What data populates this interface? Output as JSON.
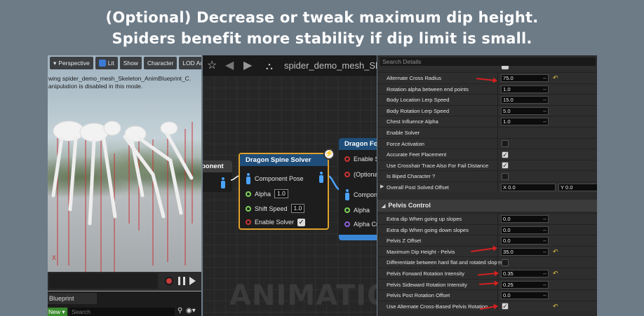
{
  "caption": {
    "line1": "(Optional) Decrease or tweak maximum dip height.",
    "line2": "Spiders benefit more stability if dip limit is small."
  },
  "viewport": {
    "toolbar": [
      "Perspective",
      "Lit",
      "Show",
      "Character",
      "LOD Auto"
    ],
    "status_line1": "wing spider_demo_mesh_Skeleton_AnimBlueprint_C.",
    "status_line2": "anipulation is disabled in this mode.",
    "axis_label": "X"
  },
  "blueprint_panel": {
    "tab": "Blueprint",
    "new_button": "New ▾",
    "search_placeholder": "Search"
  },
  "graph": {
    "breadcrumb": "spider_demo_mesh_Sk",
    "watermark": "ANIMATION",
    "left_node_title": "ponent",
    "main_node": {
      "title": "Dragon Spine Solver",
      "pins": [
        {
          "label": "Component Pose"
        },
        {
          "label": "Alpha",
          "value": "1.0"
        },
        {
          "label": "Shift Speed",
          "value": "1.0"
        },
        {
          "label": "Enable Solver",
          "checked": true
        }
      ]
    },
    "right_node": {
      "title": "Dragon Fo",
      "pins": [
        "Enable S",
        "(Optiona",
        "Compon",
        "Alpha",
        "Alpha Cu"
      ]
    }
  },
  "details": {
    "search_placeholder": "Search Details",
    "properties_top": [
      {
        "label": "Alternate Cross Radius",
        "value": "75.0",
        "reset": true,
        "arrow": true
      },
      {
        "label": "Rotation alpha between end points",
        "value": "1.0"
      },
      {
        "label": "Body Location Lerp Speed",
        "value": "15.0"
      },
      {
        "label": "Body Rotation Lerp Speed",
        "value": "5.0"
      },
      {
        "label": "Chest Influence Alpha",
        "value": "1.0"
      },
      {
        "label": "Enable Solver",
        "value": ""
      },
      {
        "label": "Force Activation",
        "check": false
      },
      {
        "label": "Accurate Feet Placement",
        "check": true
      },
      {
        "label": "Use Crosshair Trace Also For Fail Distance",
        "check": true
      },
      {
        "label": "Is Biped Character ?",
        "check": false
      }
    ],
    "offset_row": {
      "label": "Overall Post Solved Offset",
      "x": "X 0.0",
      "y": "Y 0.0"
    },
    "section_title": "Pelvis Control",
    "properties_pelvis": [
      {
        "label": "Extra dip When going up slopes",
        "value": "0.0"
      },
      {
        "label": "Extra dip When going down slopes",
        "value": "0.0"
      },
      {
        "label": "Pelvis Z Offset",
        "value": "0.0"
      },
      {
        "label": "Maximum Dip Height - Pelvis",
        "value": "35.0",
        "reset": true,
        "arrow": true
      },
      {
        "label": "Differentiate between hard flat and rotated slopes",
        "check": false
      },
      {
        "label": "Pelvis Forward Rotation Intensity",
        "value": "0.35",
        "reset": true,
        "arrow": true
      },
      {
        "label": "Pelvis Sideward Rotation Intensity",
        "value": "0.25",
        "arrow": true
      },
      {
        "label": "Pelvis Post Rotation Offset",
        "value": "0.0"
      },
      {
        "label": "Use Alternate Cross-Based Pelvis Rotation",
        "check": true,
        "reset": true,
        "arrow": true
      }
    ]
  },
  "colors": {
    "background": "#6d7b87",
    "node_highlight": "#e0a12b",
    "accent_red": "#d62020"
  }
}
